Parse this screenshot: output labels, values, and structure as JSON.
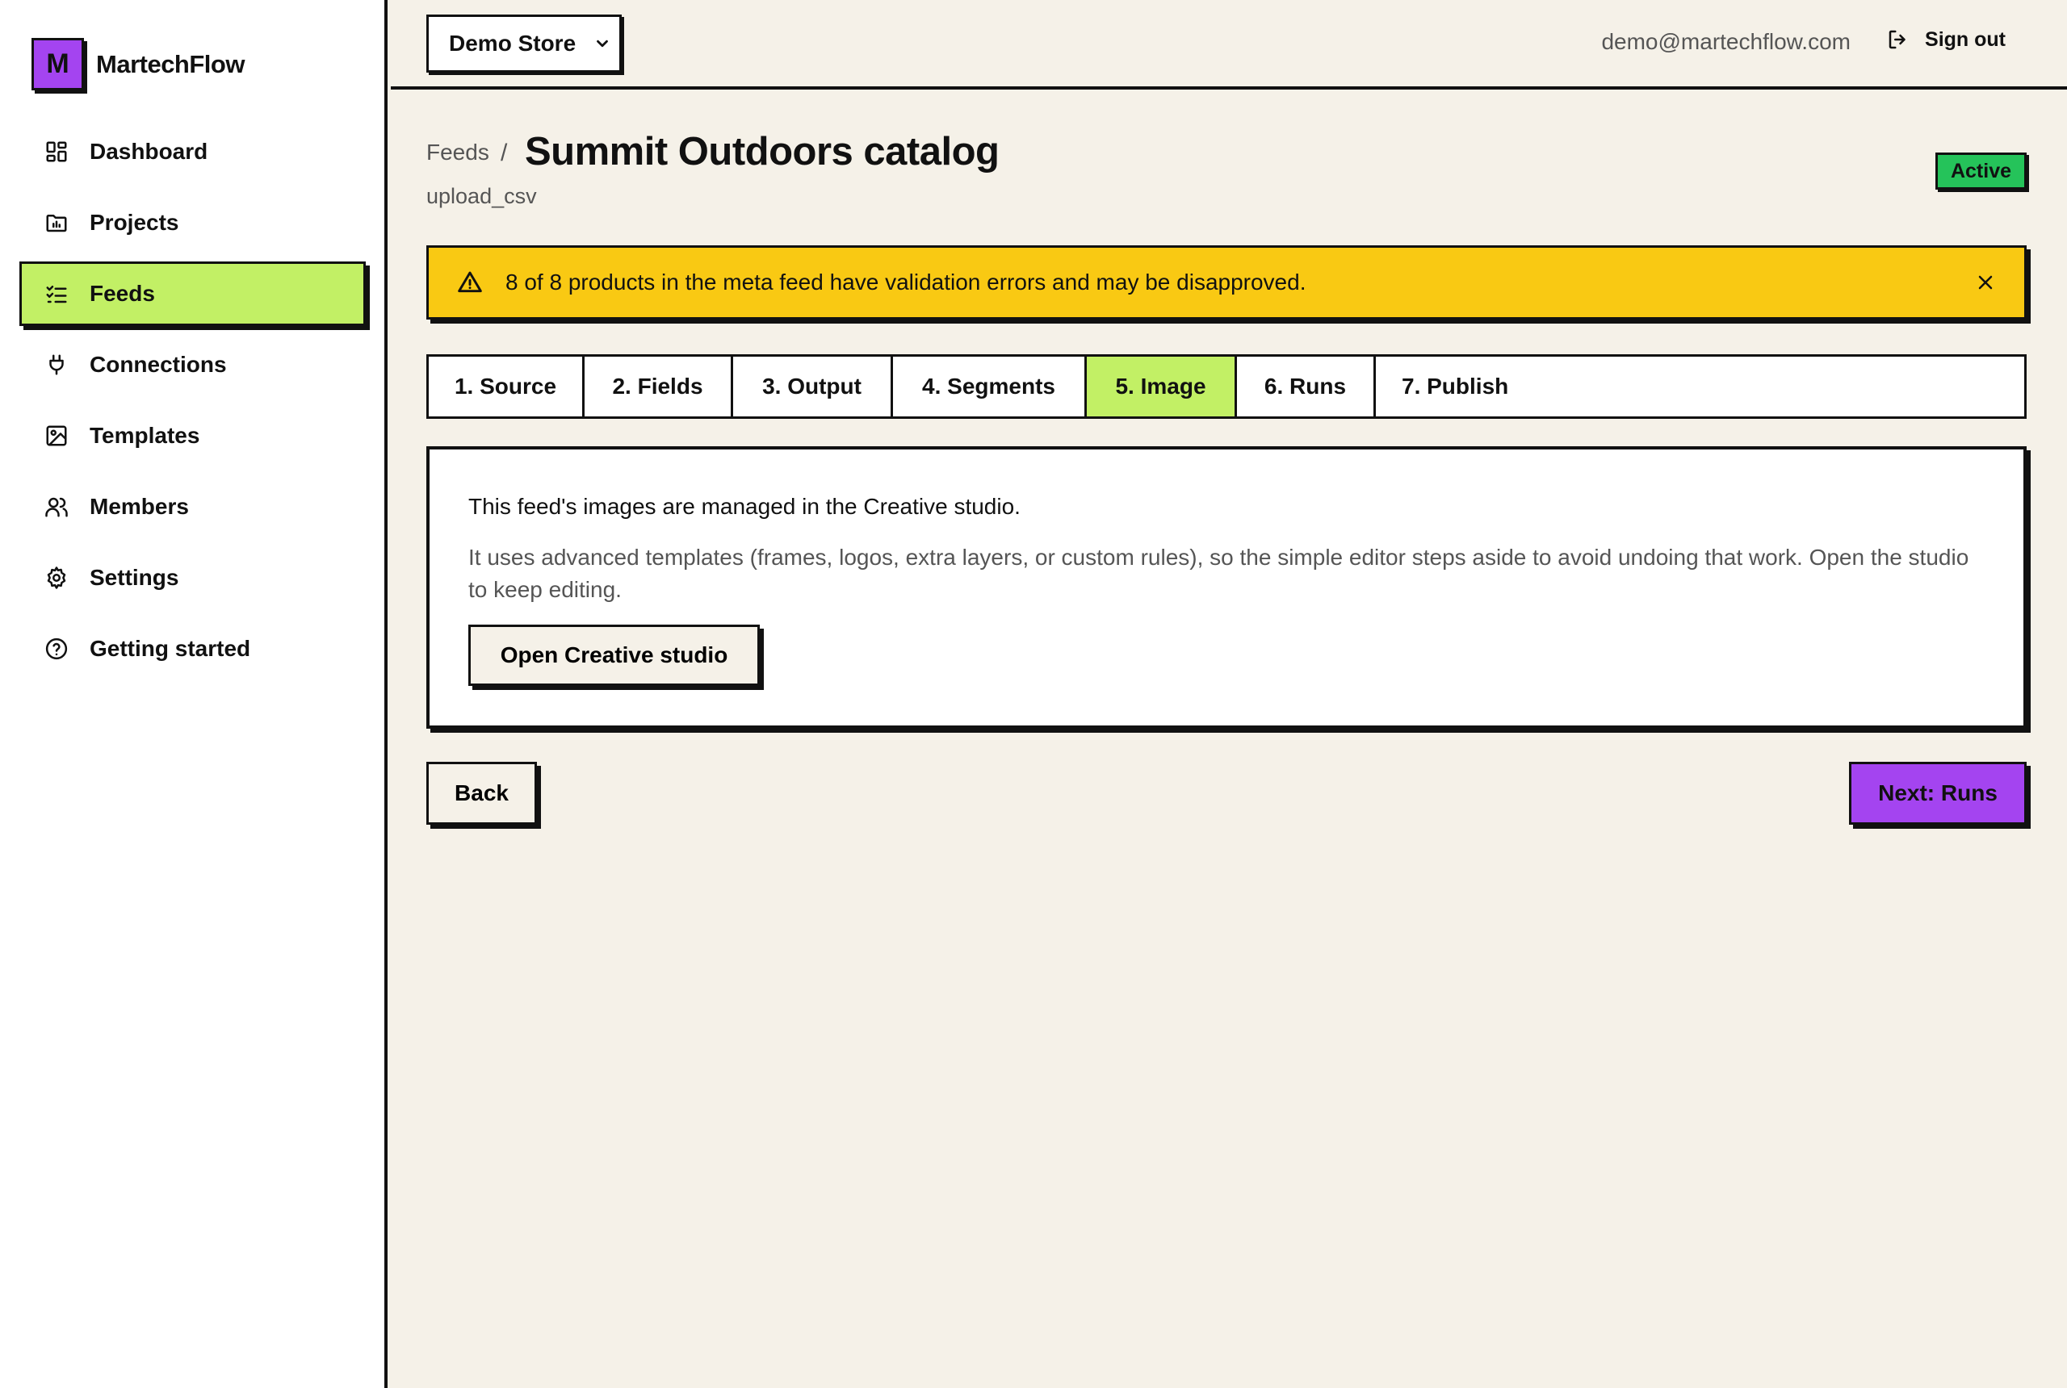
{
  "brand": {
    "logo_letter": "M",
    "name": "MartechFlow",
    "accent": "#a444f0"
  },
  "sidebar": {
    "items": [
      {
        "label": "Dashboard",
        "icon": "dashboard-icon"
      },
      {
        "label": "Projects",
        "icon": "folder-chart-icon"
      },
      {
        "label": "Feeds",
        "icon": "list-checks-icon",
        "active": true
      },
      {
        "label": "Connections",
        "icon": "plug-icon"
      },
      {
        "label": "Templates",
        "icon": "image-icon"
      },
      {
        "label": "Members",
        "icon": "users-icon"
      },
      {
        "label": "Settings",
        "icon": "gear-icon"
      },
      {
        "label": "Getting started",
        "icon": "help-circle-icon"
      }
    ],
    "active_color": "#c2f065"
  },
  "topbar": {
    "store_selected": "Demo Store",
    "user_email": "demo@martechflow.com",
    "sign_out_label": "Sign out"
  },
  "header": {
    "breadcrumb": "Feeds",
    "breadcrumb_sep": "/",
    "title": "Summit Outdoors catalog",
    "subtitle": "upload_csv",
    "status": "Active",
    "status_color": "#25c35a"
  },
  "alert": {
    "text": "8 of 8 products in the meta feed have validation errors and may be disapproved.",
    "color": "#f9c913"
  },
  "tabs": [
    {
      "label": "1. Source"
    },
    {
      "label": "2. Fields"
    },
    {
      "label": "3. Output"
    },
    {
      "label": "4. Segments"
    },
    {
      "label": "5. Image",
      "active": true
    },
    {
      "label": "6. Runs"
    },
    {
      "label": "7. Publish"
    }
  ],
  "card": {
    "title": "This feed's images are managed in the Creative studio.",
    "body": "It uses advanced templates (frames, logos, extra layers, or custom rules), so the simple editor steps aside to avoid undoing that work. Open the studio to keep editing.",
    "button_label": "Open Creative studio"
  },
  "footer": {
    "back_label": "Back",
    "next_label": "Next: Runs"
  }
}
